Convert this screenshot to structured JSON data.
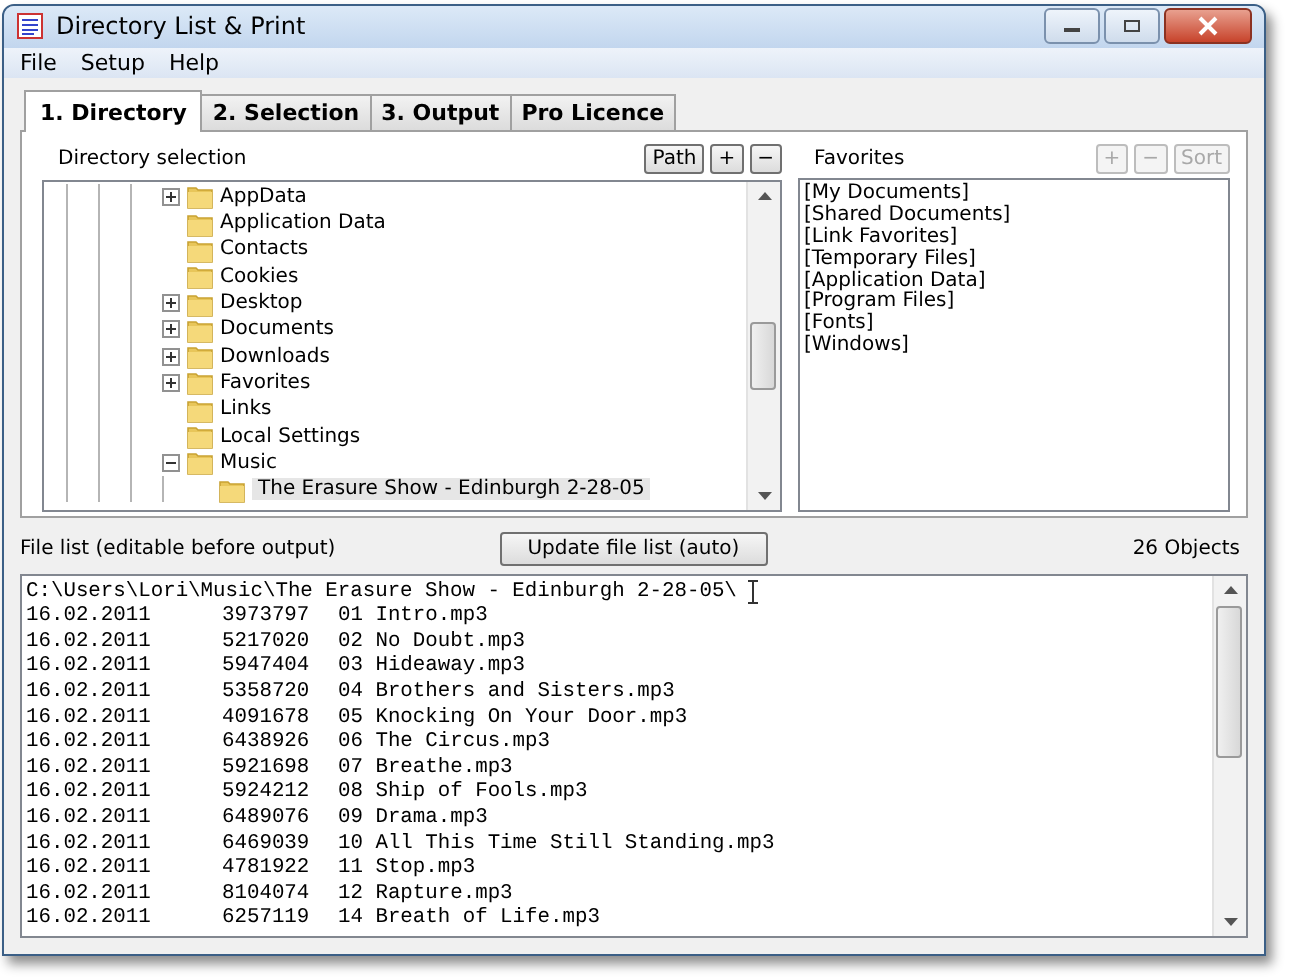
{
  "window": {
    "title": "Directory List & Print"
  },
  "menu": [
    "File",
    "Setup",
    "Help"
  ],
  "tabs": [
    {
      "label": "1. Directory",
      "selected": true
    },
    {
      "label": "2. Selection",
      "selected": false
    },
    {
      "label": "3. Output",
      "selected": false
    },
    {
      "label": "Pro Licence",
      "selected": false
    }
  ],
  "directory": {
    "label": "Directory selection",
    "buttons": [
      {
        "label": "Path",
        "disabled": false
      },
      {
        "label": "+",
        "disabled": false
      },
      {
        "label": "−",
        "disabled": false
      }
    ],
    "tree": [
      {
        "label": "AppData",
        "expanded": false,
        "selected": false
      },
      {
        "label": "Application Data",
        "selected": false
      },
      {
        "label": "Contacts",
        "selected": false
      },
      {
        "label": "Cookies",
        "selected": false
      },
      {
        "label": "Desktop",
        "expanded": false,
        "selected": false
      },
      {
        "label": "Documents",
        "expanded": false,
        "selected": false
      },
      {
        "label": "Downloads",
        "expanded": false,
        "selected": false
      },
      {
        "label": "Favorites",
        "expanded": false,
        "selected": false
      },
      {
        "label": "Links",
        "selected": false
      },
      {
        "label": "Local Settings",
        "selected": false
      },
      {
        "label": "Music",
        "expanded": true,
        "selected": false,
        "children": [
          {
            "label": "The Erasure Show - Edinburgh 2-28-05",
            "selected": true
          }
        ]
      }
    ]
  },
  "favorites": {
    "label": "Favorites",
    "buttons": [
      {
        "label": "+",
        "disabled": true
      },
      {
        "label": "−",
        "disabled": true
      },
      {
        "label": "Sort",
        "disabled": true
      }
    ],
    "items": [
      "[My Documents]",
      "[Shared Documents]",
      "[Link Favorites]",
      "[Temporary Files]",
      "[Application Data]",
      "[Program Files]",
      "[Fonts]",
      "[Windows]"
    ]
  },
  "file_list": {
    "label": "File list (editable before output)",
    "update_button": "Update file list (auto)",
    "count": "26 Objects",
    "path": "C:\\Users\\Lori\\Music\\The Erasure Show - Edinburgh 2-28-05\\",
    "rows": [
      {
        "date": "16.02.2011",
        "size": "3973797",
        "name": "01 Intro.mp3"
      },
      {
        "date": "16.02.2011",
        "size": "5217020",
        "name": "02 No Doubt.mp3"
      },
      {
        "date": "16.02.2011",
        "size": "5947404",
        "name": "03 Hideaway.mp3"
      },
      {
        "date": "16.02.2011",
        "size": "5358720",
        "name": "04 Brothers and Sisters.mp3"
      },
      {
        "date": "16.02.2011",
        "size": "4091678",
        "name": "05 Knocking On Your Door.mp3"
      },
      {
        "date": "16.02.2011",
        "size": "6438926",
        "name": "06 The Circus.mp3"
      },
      {
        "date": "16.02.2011",
        "size": "5921698",
        "name": "07 Breathe.mp3"
      },
      {
        "date": "16.02.2011",
        "size": "5924212",
        "name": "08 Ship of Fools.mp3"
      },
      {
        "date": "16.02.2011",
        "size": "6489076",
        "name": "09 Drama.mp3"
      },
      {
        "date": "16.02.2011",
        "size": "6469039",
        "name": "10 All This Time Still Standing.mp3"
      },
      {
        "date": "16.02.2011",
        "size": "4781922",
        "name": "11 Stop.mp3"
      },
      {
        "date": "16.02.2011",
        "size": "8104074",
        "name": "12 Rapture.mp3"
      },
      {
        "date": "16.02.2011",
        "size": "6257119",
        "name": "14 Breath of Life.mp3"
      }
    ]
  }
}
